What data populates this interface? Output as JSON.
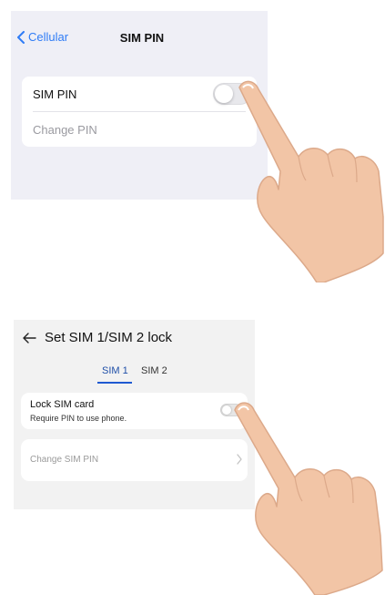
{
  "ios": {
    "back_label": "Cellular",
    "title": "SIM PIN",
    "rows": [
      {
        "label": "SIM PIN",
        "toggle_on": false
      },
      {
        "label": "Change PIN"
      }
    ]
  },
  "android": {
    "title": "Set SIM 1/SIM 2 lock",
    "tabs": [
      {
        "label": "SIM 1",
        "selected": true
      },
      {
        "label": "SIM 2",
        "selected": false
      }
    ],
    "lock_row": {
      "title": "Lock SIM card",
      "subtitle": "Require PIN to use phone.",
      "toggle_on": false
    },
    "change_row": {
      "label": "Change SIM PIN"
    }
  },
  "colors": {
    "ios_accent": "#2f7cf6",
    "ios_background": "#efeff6",
    "android_background": "#f2f2f2",
    "android_tab_accent": "#1f5ad1",
    "hand_skin": "#f2c5a6"
  },
  "icons": {
    "ios_back": "chevron-left-icon",
    "android_back": "arrow-left-icon",
    "android_row": "chevron-right-icon"
  }
}
